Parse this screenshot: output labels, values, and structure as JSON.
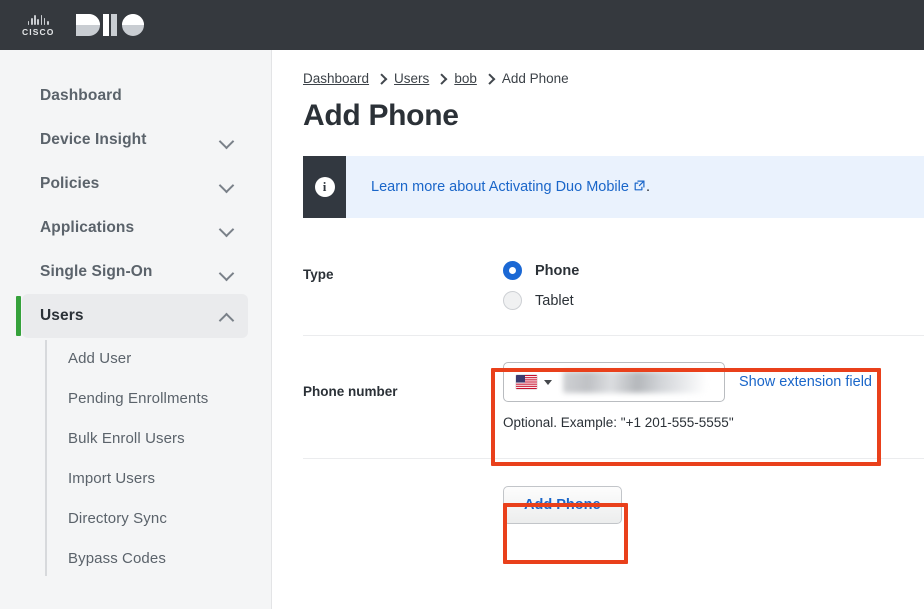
{
  "topbar": {
    "cisco_wordmark": "CISCO",
    "product_logo": "duo-logo",
    "bar_color": "#35393e"
  },
  "sidebar": {
    "items": [
      {
        "label": "Dashboard",
        "expandable": false,
        "active": false
      },
      {
        "label": "Device Insight",
        "expandable": true,
        "active": false,
        "chevron": "chevron-down-icon"
      },
      {
        "label": "Policies",
        "expandable": true,
        "active": false,
        "chevron": "chevron-down-icon"
      },
      {
        "label": "Applications",
        "expandable": true,
        "active": false,
        "chevron": "chevron-down-icon"
      },
      {
        "label": "Single Sign-On",
        "expandable": true,
        "active": false,
        "chevron": "chevron-down-icon"
      },
      {
        "label": "Users",
        "expandable": true,
        "active": true,
        "chevron": "chevron-up-icon"
      }
    ],
    "subitems": [
      {
        "label": "Add User"
      },
      {
        "label": "Pending Enrollments"
      },
      {
        "label": "Bulk Enroll Users"
      },
      {
        "label": "Import Users"
      },
      {
        "label": "Directory Sync"
      },
      {
        "label": "Bypass Codes"
      }
    ],
    "active_accent_color": "#35a13b"
  },
  "breadcrumb": {
    "items": [
      {
        "label": "Dashboard",
        "link": true
      },
      {
        "label": "Users",
        "link": true
      },
      {
        "label": "bob",
        "link": true
      },
      {
        "label": "Add Phone",
        "link": false
      }
    ]
  },
  "page": {
    "title": "Add Phone"
  },
  "banner": {
    "icon": "info-icon",
    "link_text": "Learn more about Activating Duo Mobile",
    "external_icon": "external-link-icon",
    "trailing_text": ".",
    "background": "#eaf2fd",
    "icon_background": "#323840",
    "link_color": "#1a66c9"
  },
  "form": {
    "type_row": {
      "label": "Type",
      "options": [
        {
          "label": "Phone",
          "selected": true
        },
        {
          "label": "Tablet",
          "selected": false
        }
      ],
      "selected_color": "#1b68d4"
    },
    "phone_row": {
      "label": "Phone number",
      "country_flag": "us-flag-icon",
      "country_caret": "chevron-down-icon",
      "value": "",
      "value_redacted": true,
      "extension_link": "Show extension field",
      "help_text": "Optional. Example: \"+1 201-555-5555\""
    },
    "submit": {
      "label": "Add Phone"
    }
  },
  "annotations": {
    "color": "#e9401b",
    "boxes": [
      {
        "name": "phone-number-highlight"
      },
      {
        "name": "add-phone-button-highlight"
      }
    ]
  }
}
